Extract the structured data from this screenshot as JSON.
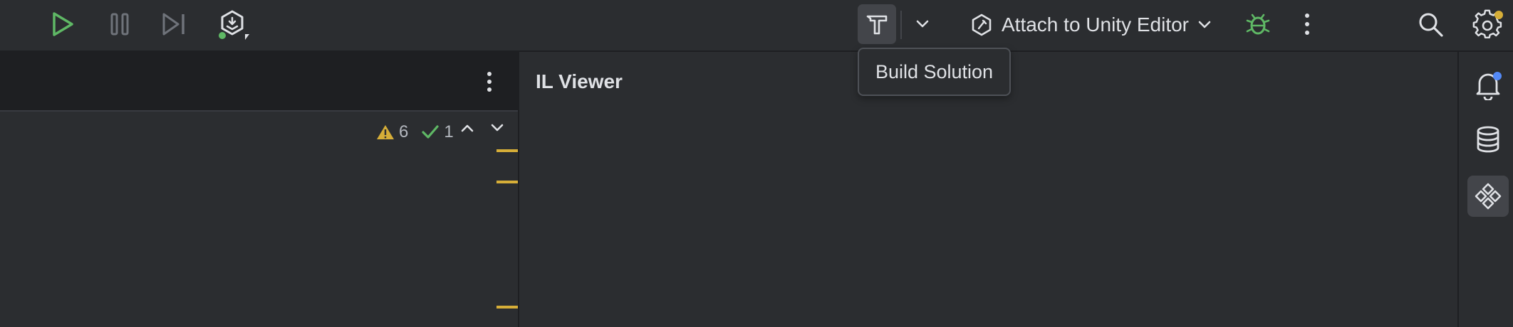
{
  "toolbar": {
    "run_icon": "play-icon",
    "pause_icon": "pause-icon",
    "step_icon": "step-over-icon",
    "unity_icon": "unity-icon",
    "build_icon": "hammer-icon",
    "dropdown_icon": "chevron-down-icon",
    "run_config": {
      "label": "Attach to Unity Editor",
      "icon": "unity-attach-icon"
    },
    "debug_icon": "bug-icon",
    "more_icon": "kebab-icon",
    "search_icon": "search-icon",
    "settings_icon": "gear-icon"
  },
  "tooltip": {
    "text": "Build Solution"
  },
  "editor": {
    "warnings_count": "6",
    "ok_count": "1"
  },
  "il_viewer": {
    "title": "IL Viewer"
  },
  "right_strip": {
    "items": [
      "notifications-icon",
      "database-icon",
      "structure-icon"
    ]
  },
  "colors": {
    "accent_green": "#5fb865",
    "warning_yellow": "#d6ae38",
    "notification_blue": "#548af7"
  }
}
